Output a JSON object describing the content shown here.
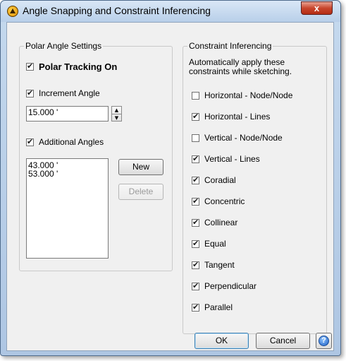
{
  "window": {
    "title": "Angle Snapping and Constraint Inferencing",
    "close_glyph": "x"
  },
  "polar": {
    "group_label": "Polar Angle Settings",
    "polar_tracking": {
      "label": "Polar Tracking On",
      "checked": true
    },
    "increment_angle": {
      "label": "Increment Angle",
      "checked": true,
      "value": "15.000 '"
    },
    "additional_angles": {
      "label": "Additional Angles",
      "checked": true,
      "items": [
        "43.000 '",
        "53.000 '"
      ]
    },
    "new_label": "New",
    "delete_label": "Delete"
  },
  "constraints": {
    "group_label": "Constraint Inferencing",
    "description": "Automatically apply these constraints while sketching.",
    "items": [
      {
        "label": "Horizontal - Node/Node",
        "checked": false
      },
      {
        "label": "Horizontal - Lines",
        "checked": true
      },
      {
        "label": "Vertical - Node/Node",
        "checked": false
      },
      {
        "label": "Vertical - Lines",
        "checked": true
      },
      {
        "label": "Coradial",
        "checked": true
      },
      {
        "label": "Concentric",
        "checked": true
      },
      {
        "label": "Collinear",
        "checked": true
      },
      {
        "label": "Equal",
        "checked": true
      },
      {
        "label": "Tangent",
        "checked": true
      },
      {
        "label": "Perpendicular",
        "checked": true
      },
      {
        "label": "Parallel",
        "checked": true
      }
    ]
  },
  "footer": {
    "ok_label": "OK",
    "cancel_label": "Cancel",
    "help_glyph": "?"
  },
  "icons": {
    "app": "app-logo-icon",
    "help": "help-icon",
    "spin_up": "▲",
    "spin_down": "▼"
  }
}
